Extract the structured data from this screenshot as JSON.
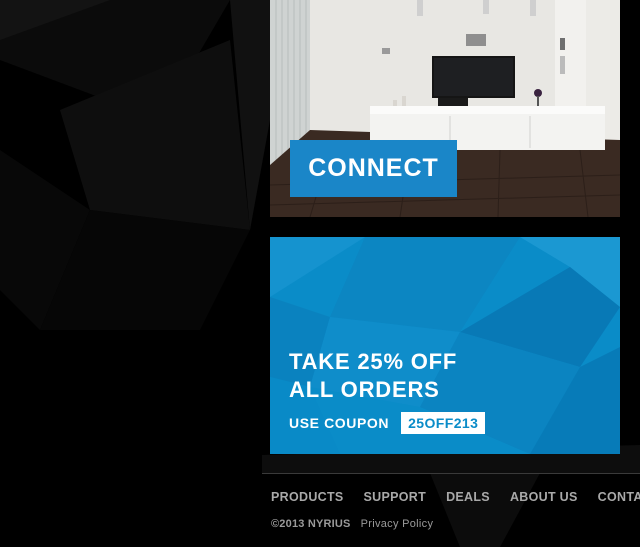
{
  "promos": {
    "connect": {
      "button_label": "CONNECT"
    },
    "coupon": {
      "headline_line1": "TAKE 25% OFF",
      "headline_line2": "ALL ORDERS",
      "coupon_label": "USE COUPON",
      "coupon_code": "25OFF213"
    }
  },
  "footer": {
    "nav": [
      {
        "label": "PRODUCTS"
      },
      {
        "label": "SUPPORT"
      },
      {
        "label": "DEALS"
      },
      {
        "label": "ABOUT US"
      },
      {
        "label": "CONTACT"
      }
    ],
    "copyright": "©2013 NYRIUS",
    "privacy_link": "Privacy Policy"
  },
  "colors": {
    "page_background": "#000000",
    "accent_blue": "#1a86c8",
    "coupon_blue": "#0a8cc8",
    "footer_text": "#a9a9a9"
  }
}
